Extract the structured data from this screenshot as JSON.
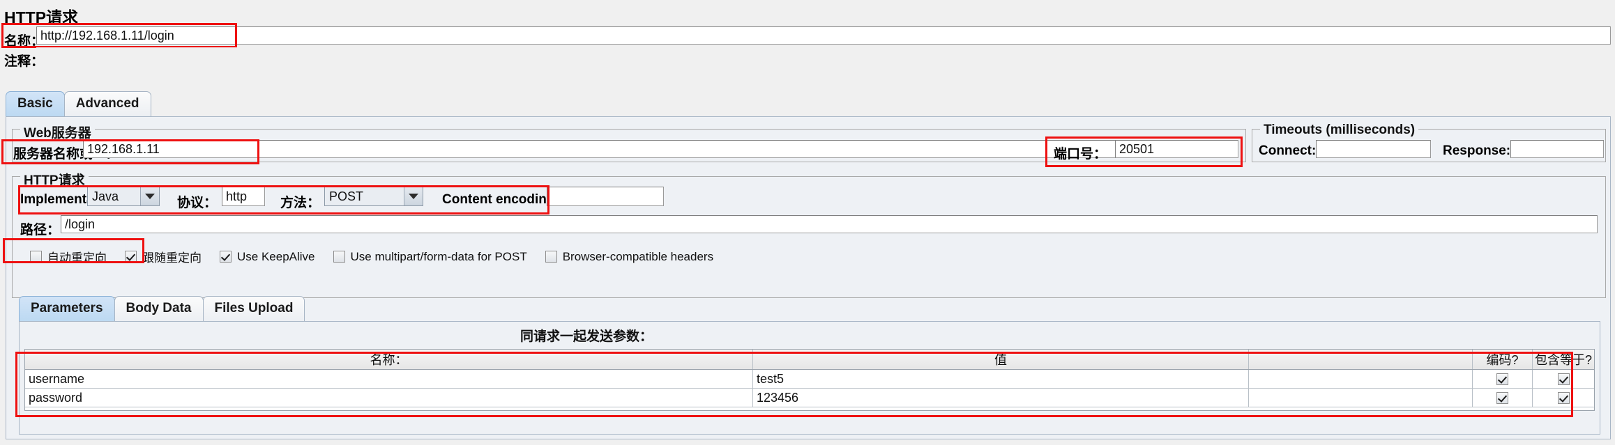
{
  "window": {
    "title": "HTTP请求"
  },
  "form": {
    "name_label": "名称：",
    "name_value": "http://192.168.1.11/login",
    "comment_label": "注释：",
    "comment_value": ""
  },
  "main_tabs": [
    {
      "label": "Basic",
      "active": true
    },
    {
      "label": "Advanced",
      "active": false
    }
  ],
  "web_server": {
    "group_title": "Web服务器",
    "server_label": "服务器名称或IP：",
    "server_value": "192.168.1.11",
    "port_label": "端口号：",
    "port_value": "20501"
  },
  "timeouts": {
    "group_title": "Timeouts (milliseconds)",
    "connect_label": "Connect:",
    "connect_value": "",
    "response_label": "Response:",
    "response_value": ""
  },
  "http_request": {
    "group_title": "HTTP请求",
    "implementation_label": "Implementation:",
    "implementation_value": "Java",
    "protocol_label": "协议：",
    "protocol_value": "http",
    "method_label": "方法：",
    "method_value": "POST",
    "content_encoding_label": "Content encoding:",
    "content_encoding_value": "",
    "path_label": "路径：",
    "path_value": "/login"
  },
  "options": [
    {
      "label": "自动重定向",
      "checked": false
    },
    {
      "label": "跟随重定向",
      "checked": true
    },
    {
      "label": "Use KeepAlive",
      "checked": true
    },
    {
      "label": "Use multipart/form-data for POST",
      "checked": false
    },
    {
      "label": "Browser-compatible headers",
      "checked": false
    }
  ],
  "param_tabs": [
    {
      "label": "Parameters",
      "active": true
    },
    {
      "label": "Body Data",
      "active": false
    },
    {
      "label": "Files Upload",
      "active": false
    }
  ],
  "params_table": {
    "send_with_request_label": "同请求一起发送参数：",
    "columns": [
      "名称：",
      "值",
      "",
      "编码?",
      "包含等于?"
    ],
    "rows": [
      {
        "name": "username",
        "value": "test5",
        "spacer": "",
        "encode": true,
        "include_equals": true
      },
      {
        "name": "password",
        "value": "123456",
        "spacer": "",
        "encode": true,
        "include_equals": true
      }
    ]
  },
  "colors": {
    "highlight": "#ee1111",
    "tab_active": "#bcd9f2",
    "panel": "#eef1f5",
    "background": "#f0f0f0"
  }
}
